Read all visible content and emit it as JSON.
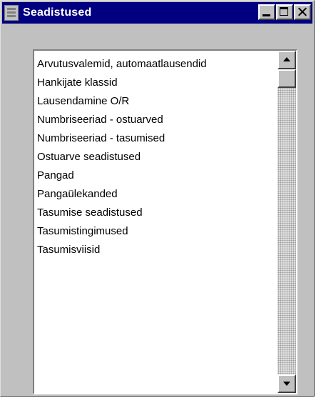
{
  "window": {
    "title": "Seadistused",
    "icon": "app-icon"
  },
  "list": {
    "items": [
      {
        "label": "Arvutusvalemid, automaatlausendid"
      },
      {
        "label": "Hankijate klassid"
      },
      {
        "label": "Lausendamine O/R"
      },
      {
        "label": "Numbriseeriad - ostuarved"
      },
      {
        "label": "Numbriseeriad - tasumised"
      },
      {
        "label": "Ostuarve seadistused"
      },
      {
        "label": "Pangad"
      },
      {
        "label": "Pangaülekanded"
      },
      {
        "label": "Tasumise seadistused"
      },
      {
        "label": "Tasumistingimused"
      },
      {
        "label": "Tasumisviisid"
      }
    ]
  },
  "colors": {
    "titlebar": "#000080",
    "window_bg": "#c0c0c0",
    "list_bg": "#ffffff"
  }
}
